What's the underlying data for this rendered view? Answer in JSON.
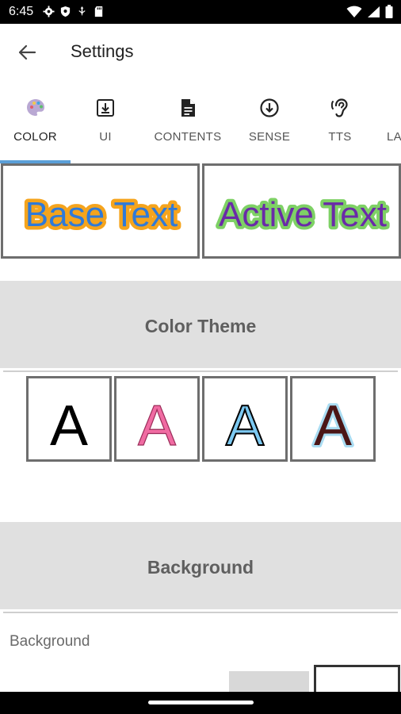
{
  "status_bar": {
    "time": "6:45",
    "icons": [
      "gear-icon",
      "shield-icon",
      "usb-icon",
      "sd-card-icon"
    ],
    "right_icons": [
      "wifi-icon",
      "signal-icon",
      "battery-icon"
    ]
  },
  "app_bar": {
    "back_icon": "arrow-left-icon",
    "title": "Settings"
  },
  "tabs": [
    {
      "label": "COLOR",
      "icon": "palette-icon",
      "active": true
    },
    {
      "label": "UI",
      "icon": "download-box-icon",
      "active": false
    },
    {
      "label": "CONTENTS",
      "icon": "document-icon",
      "active": false
    },
    {
      "label": "SENSE",
      "icon": "arrow-down-circle-icon",
      "active": false
    },
    {
      "label": "TTS",
      "icon": "hearing-icon",
      "active": false
    },
    {
      "label": "LA",
      "icon": "",
      "active": false
    }
  ],
  "preview": {
    "base_text": "Base Text",
    "active_text": "Active Text",
    "base_fill": "#2f7ad9",
    "base_stroke": "#f5a41d",
    "active_fill": "#6a2aa8",
    "active_stroke": "#7ed165"
  },
  "sections": {
    "color_theme": "Color Theme",
    "background": "Background"
  },
  "themes": [
    {
      "letter": "A",
      "fill": "#000000",
      "outline": "none"
    },
    {
      "letter": "A",
      "fill": "#f06ba2",
      "outline": "#9b2d5a"
    },
    {
      "letter": "A",
      "fill": "#7cc9f2",
      "outline": "#000000"
    },
    {
      "letter": "A",
      "fill": "#4b1616",
      "outline": "#a9dcf2"
    }
  ],
  "background": {
    "label": "Background"
  }
}
